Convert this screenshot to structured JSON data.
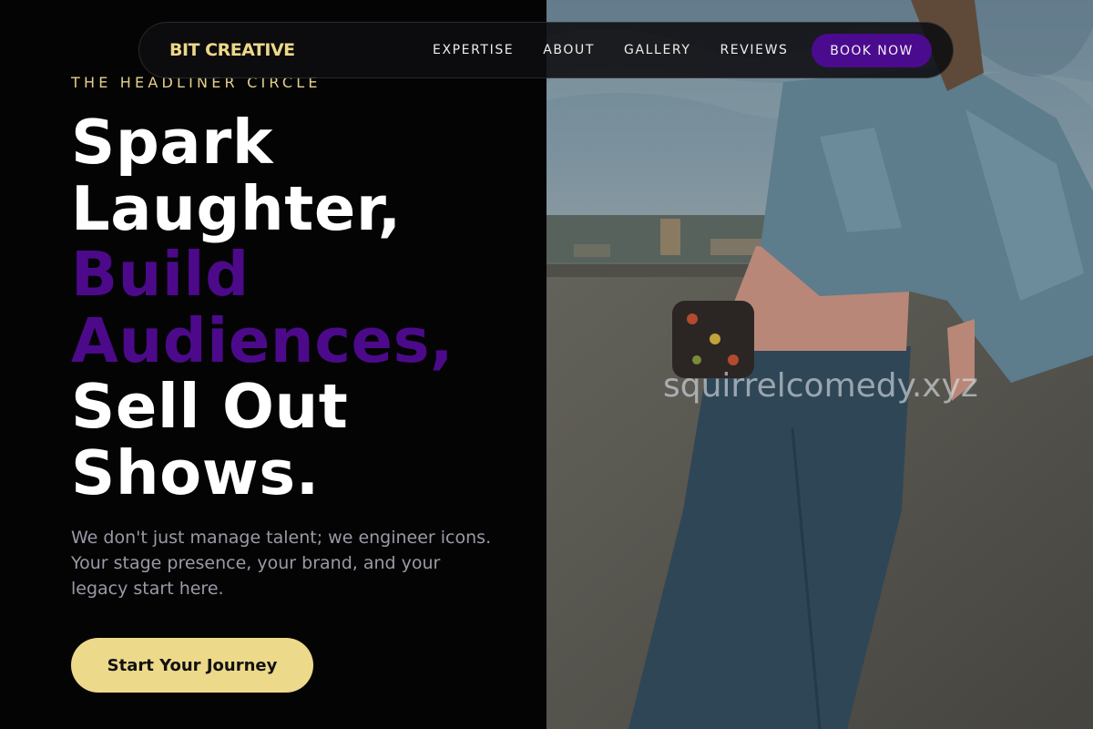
{
  "brand": {
    "name": "BIT CREATIVE",
    "accent_color": "#4b0b8f",
    "gold_color": "#ecd889"
  },
  "nav": {
    "links": [
      "EXPERTISE",
      "ABOUT",
      "GALLERY",
      "REVIEWS"
    ],
    "cta_label": "BOOK NOW"
  },
  "hero": {
    "eyebrow": "THE HEADLINER CIRCLE",
    "headline_lines": [
      {
        "text": "Spark",
        "accent": false
      },
      {
        "text": "Laughter,",
        "accent": false
      },
      {
        "text": "Build",
        "accent": true
      },
      {
        "text": "Audiences,",
        "accent": true
      },
      {
        "text": "Sell Out",
        "accent": false
      },
      {
        "text": "Shows.",
        "accent": false
      }
    ],
    "subtext": "We don't just manage talent; we engineer icons. Your stage presence, your brand, and your legacy start here.",
    "cta_label": "Start Your Journey"
  },
  "image": {
    "watermark": "squirrelcomedy.xyz"
  }
}
